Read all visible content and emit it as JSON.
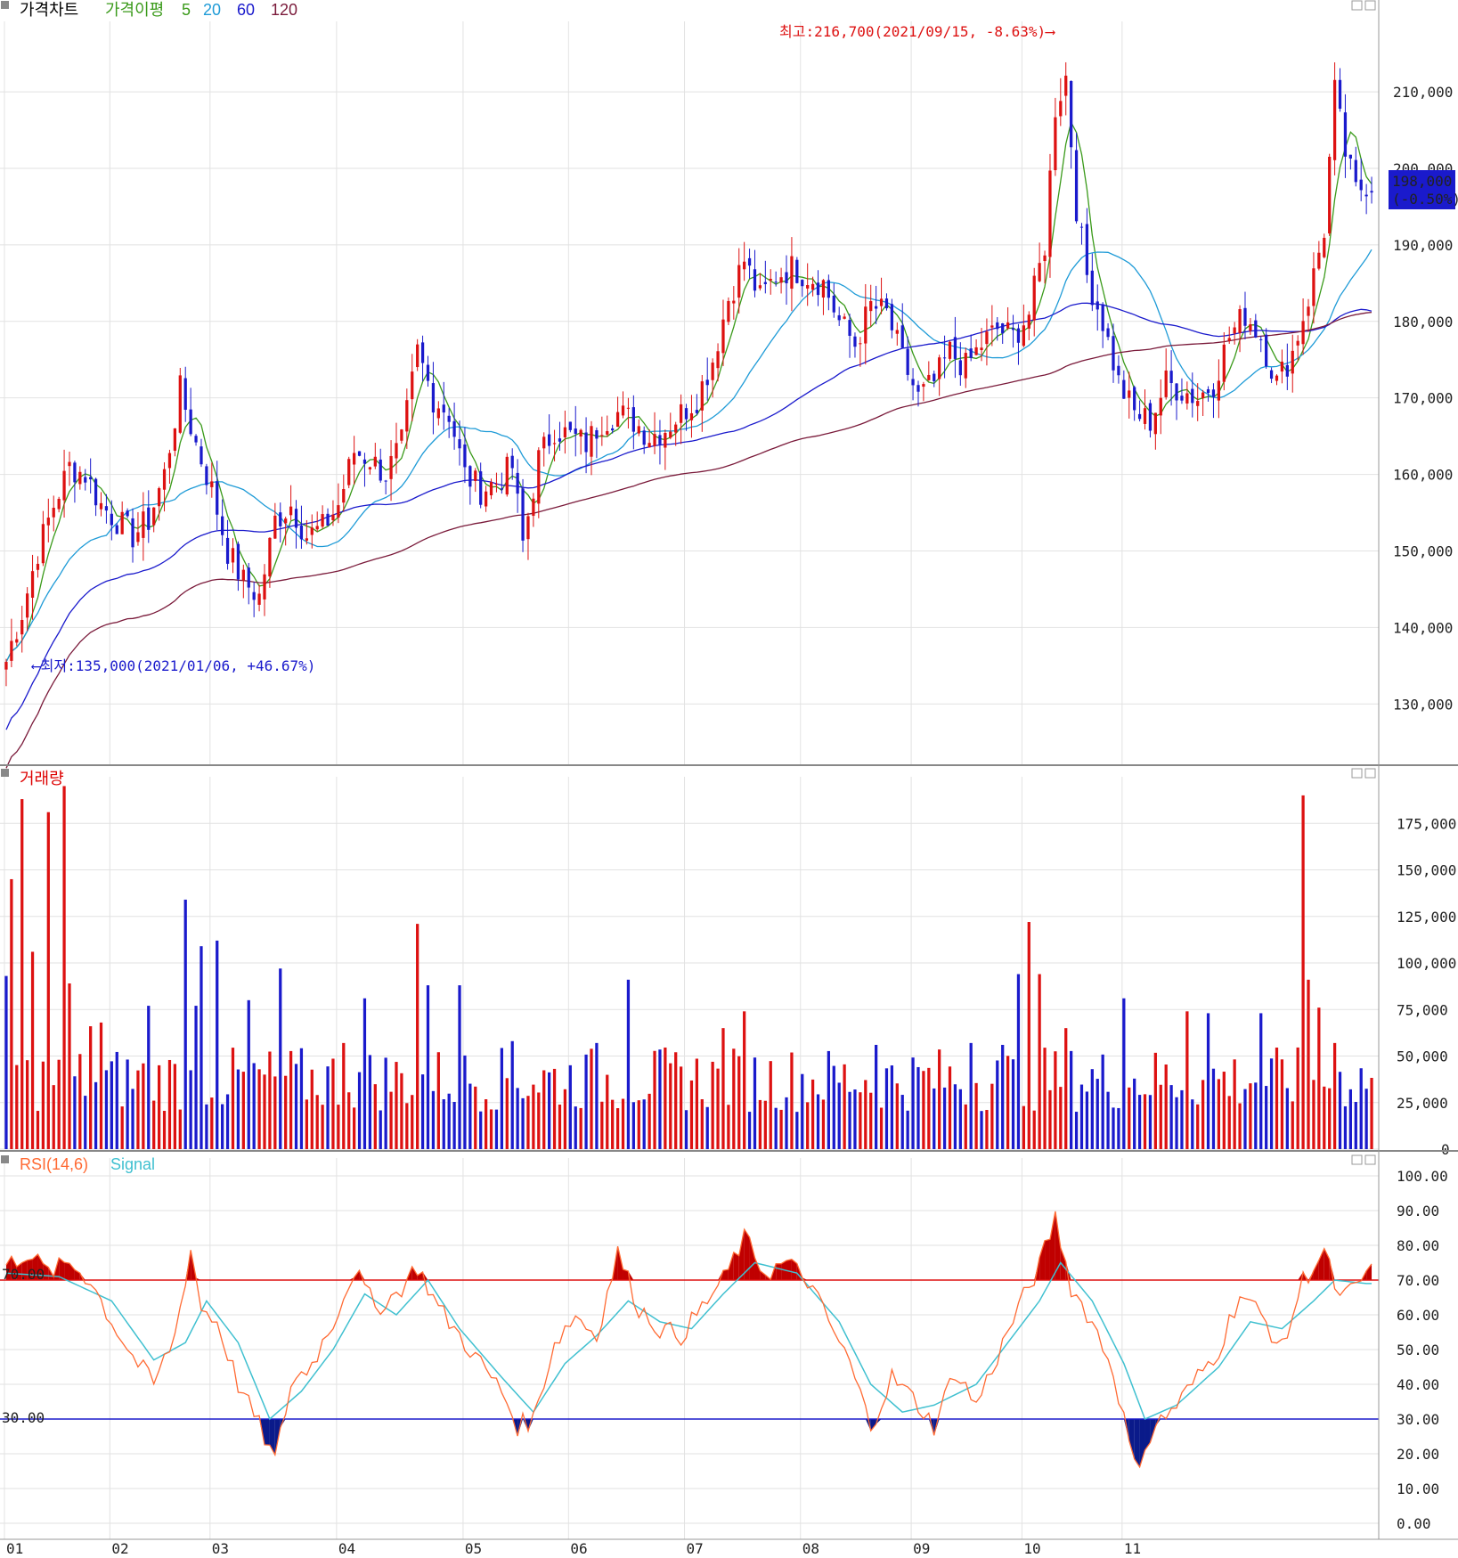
{
  "chart_data": [
    {
      "type": "candlestick",
      "legend": [
        {
          "label": "가격차트",
          "color": "#000000"
        },
        {
          "label": "가격이평",
          "color": "#3a9a1a"
        },
        {
          "label": "5",
          "color": "#3a9a1a"
        },
        {
          "label": "20",
          "color": "#1f9bd7"
        },
        {
          "label": "60",
          "color": "#1a1acc"
        },
        {
          "label": "120",
          "color": "#7a1a3a"
        }
      ],
      "ylim": [
        122000,
        222000
      ],
      "y_ticks": [
        "210,000",
        "200,000",
        "190,000",
        "180,000",
        "170,000",
        "160,000",
        "150,000",
        "140,000",
        "130,000"
      ],
      "y_tick_values": [
        210000,
        200000,
        190000,
        180000,
        170000,
        160000,
        150000,
        140000,
        130000
      ],
      "last_price_label": "198,000",
      "last_change_label": "(-0.50%)",
      "last_price": 198000,
      "high_annotation": "최고:216,700(2021/09/15, -8.63%)",
      "high_value": 216700,
      "low_annotation": "최저:135,000(2021/01/06, +46.67%)",
      "low_value": 135000,
      "close_series": [
        {
          "x": 0,
          "close": 136000
        },
        {
          "x": 3,
          "close": 142000
        },
        {
          "x": 6,
          "close": 150000
        },
        {
          "x": 9,
          "close": 156000
        },
        {
          "x": 12,
          "close": 161000
        },
        {
          "x": 15,
          "close": 160000
        },
        {
          "x": 18,
          "close": 156000
        },
        {
          "x": 21,
          "close": 154000
        },
        {
          "x": 24,
          "close": 152000
        },
        {
          "x": 27,
          "close": 154000
        },
        {
          "x": 30,
          "close": 160000
        },
        {
          "x": 33,
          "close": 171000
        },
        {
          "x": 36,
          "close": 164000
        },
        {
          "x": 39,
          "close": 158000
        },
        {
          "x": 42,
          "close": 150000
        },
        {
          "x": 45,
          "close": 146000
        },
        {
          "x": 48,
          "close": 144000
        },
        {
          "x": 51,
          "close": 154000
        },
        {
          "x": 54,
          "close": 156000
        },
        {
          "x": 57,
          "close": 152000
        },
        {
          "x": 60,
          "close": 153000
        },
        {
          "x": 63,
          "close": 156000
        },
        {
          "x": 66,
          "close": 163000
        },
        {
          "x": 69,
          "close": 162000
        },
        {
          "x": 72,
          "close": 160000
        },
        {
          "x": 75,
          "close": 164000
        },
        {
          "x": 78,
          "close": 176000
        },
        {
          "x": 81,
          "close": 170000
        },
        {
          "x": 84,
          "close": 168000
        },
        {
          "x": 87,
          "close": 160000
        },
        {
          "x": 90,
          "close": 158000
        },
        {
          "x": 93,
          "close": 159000
        },
        {
          "x": 96,
          "close": 161000
        },
        {
          "x": 98,
          "close": 151000
        },
        {
          "x": 101,
          "close": 162000
        },
        {
          "x": 104,
          "close": 166000
        },
        {
          "x": 107,
          "close": 165000
        },
        {
          "x": 110,
          "close": 164000
        },
        {
          "x": 113,
          "close": 167000
        },
        {
          "x": 116,
          "close": 168000
        },
        {
          "x": 119,
          "close": 167000
        },
        {
          "x": 122,
          "close": 165000
        },
        {
          "x": 125,
          "close": 166000
        },
        {
          "x": 128,
          "close": 168000
        },
        {
          "x": 131,
          "close": 170000
        },
        {
          "x": 134,
          "close": 175000
        },
        {
          "x": 137,
          "close": 183000
        },
        {
          "x": 140,
          "close": 188000
        },
        {
          "x": 143,
          "close": 183000
        },
        {
          "x": 146,
          "close": 186000
        },
        {
          "x": 149,
          "close": 187000
        },
        {
          "x": 152,
          "close": 186000
        },
        {
          "x": 155,
          "close": 185000
        },
        {
          "x": 158,
          "close": 180000
        },
        {
          "x": 161,
          "close": 177000
        },
        {
          "x": 164,
          "close": 182000
        },
        {
          "x": 167,
          "close": 181000
        },
        {
          "x": 170,
          "close": 175000
        },
        {
          "x": 173,
          "close": 170000
        },
        {
          "x": 176,
          "close": 172000
        },
        {
          "x": 179,
          "close": 176000
        },
        {
          "x": 182,
          "close": 174000
        },
        {
          "x": 185,
          "close": 177000
        },
        {
          "x": 188,
          "close": 179000
        },
        {
          "x": 191,
          "close": 178000
        },
        {
          "x": 194,
          "close": 181000
        },
        {
          "x": 197,
          "close": 190000
        },
        {
          "x": 199,
          "close": 208000
        },
        {
          "x": 201,
          "close": 212000
        },
        {
          "x": 203,
          "close": 195000
        },
        {
          "x": 205,
          "close": 186000
        },
        {
          "x": 208,
          "close": 180000
        },
        {
          "x": 211,
          "close": 172000
        },
        {
          "x": 214,
          "close": 168000
        },
        {
          "x": 217,
          "close": 167000
        },
        {
          "x": 220,
          "close": 172000
        },
        {
          "x": 223,
          "close": 171000
        },
        {
          "x": 226,
          "close": 170000
        },
        {
          "x": 229,
          "close": 172000
        },
        {
          "x": 232,
          "close": 178000
        },
        {
          "x": 235,
          "close": 181000
        },
        {
          "x": 238,
          "close": 178000
        },
        {
          "x": 241,
          "close": 172000
        },
        {
          "x": 244,
          "close": 176000
        },
        {
          "x": 247,
          "close": 183000
        },
        {
          "x": 250,
          "close": 192000
        },
        {
          "x": 252,
          "close": 210000
        },
        {
          "x": 254,
          "close": 202000
        },
        {
          "x": 256,
          "close": 197000
        },
        {
          "x": 258,
          "close": 198000
        }
      ]
    },
    {
      "type": "bar",
      "legend": [
        {
          "label": "거래량",
          "color": "#dd0000"
        }
      ],
      "ylim": [
        0,
        200000
      ],
      "y_ticks": [
        "175,000",
        "150,000",
        "125,000",
        "100,000",
        "75,000",
        "50,000",
        "25,000",
        "0"
      ],
      "y_tick_values": [
        175000,
        150000,
        125000,
        100000,
        75000,
        50000,
        25000,
        0
      ],
      "values": [
        {
          "x": 0,
          "v": 93000
        },
        {
          "x": 1,
          "v": 145000
        },
        {
          "x": 3,
          "v": 188000
        },
        {
          "x": 5,
          "v": 106000
        },
        {
          "x": 8,
          "v": 181000
        },
        {
          "x": 11,
          "v": 195000
        },
        {
          "x": 12,
          "v": 89000
        },
        {
          "x": 16,
          "v": 66000
        },
        {
          "x": 18,
          "v": 68000
        },
        {
          "x": 27,
          "v": 77000
        },
        {
          "x": 34,
          "v": 134000
        },
        {
          "x": 36,
          "v": 77000
        },
        {
          "x": 37,
          "v": 109000
        },
        {
          "x": 40,
          "v": 112000
        },
        {
          "x": 46,
          "v": 80000
        },
        {
          "x": 52,
          "v": 97000
        },
        {
          "x": 64,
          "v": 57000
        },
        {
          "x": 68,
          "v": 81000
        },
        {
          "x": 78,
          "v": 121000
        },
        {
          "x": 80,
          "v": 88000
        },
        {
          "x": 86,
          "v": 88000
        },
        {
          "x": 96,
          "v": 58000
        },
        {
          "x": 112,
          "v": 57000
        },
        {
          "x": 118,
          "v": 91000
        },
        {
          "x": 136,
          "v": 65000
        },
        {
          "x": 140,
          "v": 74000
        },
        {
          "x": 165,
          "v": 56000
        },
        {
          "x": 183,
          "v": 57000
        },
        {
          "x": 189,
          "v": 56000
        },
        {
          "x": 192,
          "v": 94000
        },
        {
          "x": 194,
          "v": 122000
        },
        {
          "x": 196,
          "v": 94000
        },
        {
          "x": 201,
          "v": 65000
        },
        {
          "x": 212,
          "v": 81000
        },
        {
          "x": 224,
          "v": 74000
        },
        {
          "x": 228,
          "v": 73000
        },
        {
          "x": 238,
          "v": 73000
        },
        {
          "x": 246,
          "v": 190000
        },
        {
          "x": 247,
          "v": 91000
        },
        {
          "x": 249,
          "v": 76000
        },
        {
          "x": 252,
          "v": 57000
        }
      ]
    },
    {
      "type": "line",
      "legend": [
        {
          "label": "RSI(14,6)",
          "color": "#ff6a33"
        },
        {
          "label": "Signal",
          "color": "#40c0d0"
        }
      ],
      "ylim": [
        0,
        100
      ],
      "y_ticks": [
        "100.00",
        "90.00",
        "80.00",
        "70.00",
        "60.00",
        "50.00",
        "40.00",
        "30.00",
        "20.00",
        "10.00",
        "0.00"
      ],
      "y_tick_values": [
        100,
        90,
        80,
        70,
        60,
        50,
        40,
        30,
        20,
        10,
        0
      ],
      "upper_level": 70,
      "lower_level": 30,
      "upper_label": "70.00",
      "lower_label": "30.00",
      "rsi": [
        {
          "x": 0,
          "v": 74
        },
        {
          "x": 4,
          "v": 78
        },
        {
          "x": 8,
          "v": 72
        },
        {
          "x": 12,
          "v": 75
        },
        {
          "x": 16,
          "v": 70
        },
        {
          "x": 20,
          "v": 58
        },
        {
          "x": 24,
          "v": 48
        },
        {
          "x": 28,
          "v": 40
        },
        {
          "x": 32,
          "v": 54
        },
        {
          "x": 35,
          "v": 79
        },
        {
          "x": 37,
          "v": 62
        },
        {
          "x": 40,
          "v": 58
        },
        {
          "x": 44,
          "v": 40
        },
        {
          "x": 48,
          "v": 28
        },
        {
          "x": 51,
          "v": 18
        },
        {
          "x": 54,
          "v": 40
        },
        {
          "x": 58,
          "v": 46
        },
        {
          "x": 62,
          "v": 58
        },
        {
          "x": 66,
          "v": 73
        },
        {
          "x": 70,
          "v": 62
        },
        {
          "x": 74,
          "v": 66
        },
        {
          "x": 78,
          "v": 74
        },
        {
          "x": 82,
          "v": 62
        },
        {
          "x": 86,
          "v": 54
        },
        {
          "x": 90,
          "v": 46
        },
        {
          "x": 94,
          "v": 38
        },
        {
          "x": 97,
          "v": 28
        },
        {
          "x": 100,
          "v": 30
        },
        {
          "x": 104,
          "v": 52
        },
        {
          "x": 108,
          "v": 60
        },
        {
          "x": 112,
          "v": 54
        },
        {
          "x": 116,
          "v": 78
        },
        {
          "x": 120,
          "v": 62
        },
        {
          "x": 124,
          "v": 56
        },
        {
          "x": 128,
          "v": 54
        },
        {
          "x": 132,
          "v": 62
        },
        {
          "x": 136,
          "v": 70
        },
        {
          "x": 140,
          "v": 82
        },
        {
          "x": 144,
          "v": 72
        },
        {
          "x": 148,
          "v": 75
        },
        {
          "x": 152,
          "v": 70
        },
        {
          "x": 156,
          "v": 58
        },
        {
          "x": 160,
          "v": 46
        },
        {
          "x": 164,
          "v": 28
        },
        {
          "x": 168,
          "v": 42
        },
        {
          "x": 172,
          "v": 36
        },
        {
          "x": 176,
          "v": 28
        },
        {
          "x": 180,
          "v": 44
        },
        {
          "x": 184,
          "v": 34
        },
        {
          "x": 188,
          "v": 48
        },
        {
          "x": 192,
          "v": 62
        },
        {
          "x": 196,
          "v": 74
        },
        {
          "x": 199,
          "v": 88
        },
        {
          "x": 202,
          "v": 68
        },
        {
          "x": 206,
          "v": 58
        },
        {
          "x": 210,
          "v": 44
        },
        {
          "x": 214,
          "v": 16
        },
        {
          "x": 218,
          "v": 28
        },
        {
          "x": 222,
          "v": 34
        },
        {
          "x": 226,
          "v": 42
        },
        {
          "x": 230,
          "v": 50
        },
        {
          "x": 234,
          "v": 66
        },
        {
          "x": 238,
          "v": 60
        },
        {
          "x": 242,
          "v": 50
        },
        {
          "x": 246,
          "v": 70
        },
        {
          "x": 250,
          "v": 78
        },
        {
          "x": 253,
          "v": 64
        },
        {
          "x": 256,
          "v": 68
        },
        {
          "x": 258,
          "v": 72
        }
      ],
      "signal": [
        {
          "x": 0,
          "v": 72
        },
        {
          "x": 10,
          "v": 71
        },
        {
          "x": 20,
          "v": 64
        },
        {
          "x": 28,
          "v": 47
        },
        {
          "x": 34,
          "v": 52
        },
        {
          "x": 38,
          "v": 64
        },
        {
          "x": 44,
          "v": 52
        },
        {
          "x": 50,
          "v": 30
        },
        {
          "x": 56,
          "v": 38
        },
        {
          "x": 62,
          "v": 50
        },
        {
          "x": 68,
          "v": 66
        },
        {
          "x": 74,
          "v": 60
        },
        {
          "x": 80,
          "v": 70
        },
        {
          "x": 86,
          "v": 56
        },
        {
          "x": 94,
          "v": 42
        },
        {
          "x": 100,
          "v": 32
        },
        {
          "x": 106,
          "v": 46
        },
        {
          "x": 112,
          "v": 54
        },
        {
          "x": 118,
          "v": 64
        },
        {
          "x": 124,
          "v": 58
        },
        {
          "x": 130,
          "v": 56
        },
        {
          "x": 136,
          "v": 66
        },
        {
          "x": 142,
          "v": 75
        },
        {
          "x": 150,
          "v": 72
        },
        {
          "x": 158,
          "v": 58
        },
        {
          "x": 164,
          "v": 40
        },
        {
          "x": 170,
          "v": 32
        },
        {
          "x": 176,
          "v": 34
        },
        {
          "x": 184,
          "v": 40
        },
        {
          "x": 190,
          "v": 52
        },
        {
          "x": 196,
          "v": 64
        },
        {
          "x": 200,
          "v": 75
        },
        {
          "x": 206,
          "v": 64
        },
        {
          "x": 212,
          "v": 46
        },
        {
          "x": 216,
          "v": 30
        },
        {
          "x": 222,
          "v": 34
        },
        {
          "x": 230,
          "v": 45
        },
        {
          "x": 236,
          "v": 58
        },
        {
          "x": 242,
          "v": 56
        },
        {
          "x": 248,
          "v": 64
        },
        {
          "x": 252,
          "v": 70
        },
        {
          "x": 258,
          "v": 69
        }
      ]
    }
  ],
  "x_axis": {
    "months": [
      "01",
      "02",
      "03",
      "04",
      "05",
      "06",
      "07",
      "08",
      "09",
      "10",
      "11"
    ],
    "month_start_index": [
      0,
      20,
      39,
      63,
      87,
      107,
      129,
      151,
      172,
      193,
      212
    ],
    "total_days": 260
  }
}
